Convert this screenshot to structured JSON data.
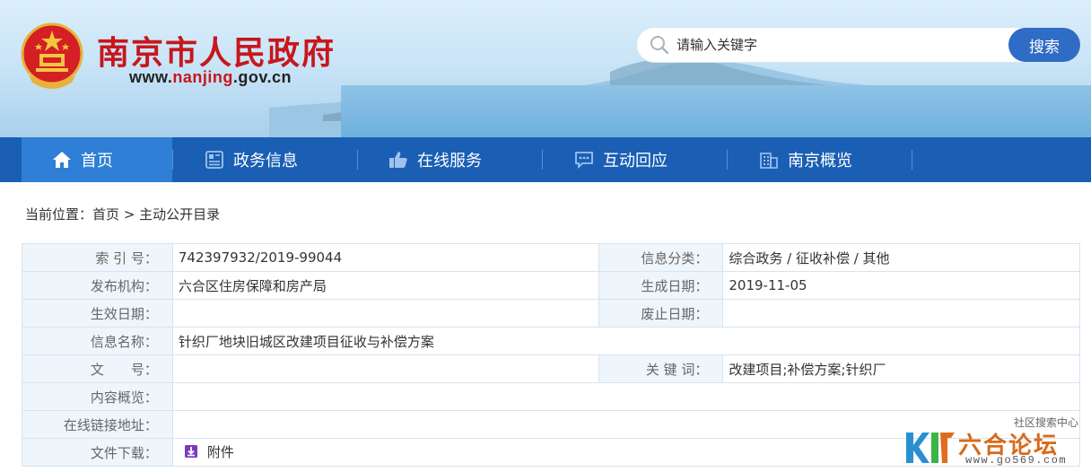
{
  "header": {
    "site_title": "南京市人民政府",
    "url_prefix": "www.",
    "url_mid": "nanjing",
    "url_suffix": ".gov.cn",
    "search": {
      "placeholder": "请输入关键字",
      "button_label": "搜索"
    }
  },
  "nav": {
    "items": [
      {
        "label": "首页",
        "icon": "home-icon",
        "active": true
      },
      {
        "label": "政务信息",
        "icon": "document-icon",
        "active": false
      },
      {
        "label": "在线服务",
        "icon": "thumbs-up-icon",
        "active": false
      },
      {
        "label": "互动回应",
        "icon": "chat-icon",
        "active": false
      },
      {
        "label": "南京概览",
        "icon": "building-icon",
        "active": false
      }
    ]
  },
  "breadcrumb": {
    "prefix": "当前位置：",
    "home": "首页",
    "separator": ">",
    "current": "主动公开目录"
  },
  "info": {
    "index_label": "索 引 号：",
    "index_value": "742397932/2019-99044",
    "category_label": "信息分类：",
    "category_value": "综合政务 / 征收补偿 / 其他",
    "publisher_label": "发布机构：",
    "publisher_value": "六合区住房保障和房产局",
    "created_label": "生成日期：",
    "created_value": "2019-11-05",
    "effective_label": "生效日期：",
    "effective_value": "",
    "abolish_label": "废止日期：",
    "abolish_value": "",
    "name_label": "信息名称：",
    "name_value": "针织厂地块旧城区改建项目征收与补偿方案",
    "doc_label": "文　　号：",
    "doc_value": "",
    "keywords_label": "关 键 词：",
    "keywords_value": "改建项目;补偿方案;针织厂",
    "summary_label": "内容概览：",
    "summary_value": "",
    "link_label": "在线链接地址：",
    "link_value": "",
    "download_label": "文件下载：",
    "download_value": "附件"
  },
  "watermark": {
    "top": "社区搜索中心",
    "name": "六合论坛",
    "url": "www.go569.com"
  },
  "colors": {
    "brand_red": "#c8161d",
    "nav_blue": "#1a5fb4",
    "nav_active": "#2f7fd6",
    "label_bg": "#eef5fb"
  }
}
